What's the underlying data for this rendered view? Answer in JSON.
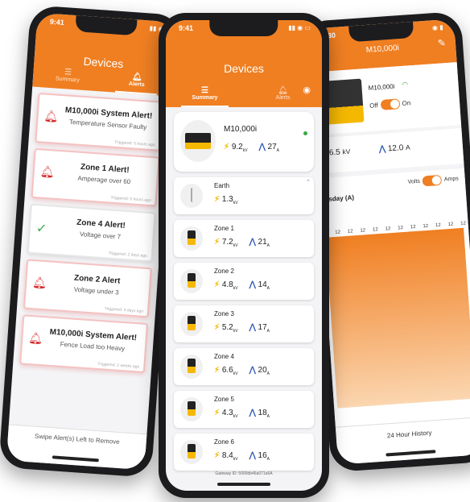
{
  "left_phone": {
    "time": "9:41",
    "title": "Devices",
    "tabs": [
      {
        "label": "Summary"
      },
      {
        "label": "Alerts"
      }
    ],
    "alerts": [
      {
        "title": "M10,000i System Alert!",
        "sub": "Temperature Sensor Faulty",
        "triggered": "Triggered: 5 hours ago",
        "icon": "bell-icon"
      },
      {
        "title": "Zone 1 Alert!",
        "sub": "Amperage over 60",
        "triggered": "Triggered: 5 hours ago",
        "icon": "bell-icon"
      },
      {
        "title": "Zone 4 Alert!",
        "sub": "Voltage over 7",
        "triggered": "Triggered: 2 days ago",
        "icon": "check-icon"
      },
      {
        "title": "Zone 2 Alert",
        "sub": "Voltage under 3",
        "triggered": "Triggered: 4 days ago",
        "icon": "bell-icon"
      },
      {
        "title": "M10,000i System Alert!",
        "sub": "Fence Load too Heavy",
        "triggered": "Triggered: 2 weeks ago",
        "icon": "bell-icon"
      }
    ],
    "footer": "Swipe Alert(s) Left to Remove"
  },
  "center_phone": {
    "time": "9:41",
    "title": "Devices",
    "tabs": [
      {
        "label": "Summary"
      },
      {
        "label": "Alerts"
      }
    ],
    "main_device": {
      "name": "M10,000i",
      "volts": "9.2",
      "volt_unit": "kV",
      "amps": "27",
      "amp_unit": "A"
    },
    "earth": {
      "name": "Earth",
      "volts": "1.3",
      "volt_unit": "kV"
    },
    "zones": [
      {
        "name": "Zone 1",
        "volts": "7.2",
        "amps": "21"
      },
      {
        "name": "Zone 2",
        "volts": "4.8",
        "amps": "14"
      },
      {
        "name": "Zone 3",
        "volts": "5.2",
        "amps": "17"
      },
      {
        "name": "Zone 4",
        "volts": "6.6",
        "amps": "20"
      },
      {
        "name": "Zone 5",
        "volts": "4.3",
        "amps": "18"
      },
      {
        "name": "Zone 6",
        "volts": "8.4",
        "amps": "16"
      }
    ],
    "units": {
      "volt": "kV",
      "amp": "A"
    },
    "gateway": "Gateway ID: 5000db46a071a6A"
  },
  "right_phone": {
    "time": "2:30",
    "title": "M10,000i",
    "device_name": "M10,000i",
    "toggle_off": "Off",
    "toggle_on": "On",
    "volts": "6.5",
    "volt_unit": "kV",
    "amps": "12.0",
    "amp_unit": "A",
    "toggle_volts": "Volts",
    "toggle_amps": "Amps",
    "chart_title": "nesday (A)",
    "history_label": "24 Hour History"
  },
  "chart_data": {
    "type": "area",
    "title": "nesday (A)",
    "xlabel": "",
    "ylabel": "",
    "x": [
      "",
      "",
      "",
      "",
      "",
      "",
      "",
      "",
      "",
      "",
      "",
      ""
    ],
    "series": [
      {
        "values": [
          12,
          12,
          12,
          12,
          12,
          12,
          12,
          12,
          12,
          12,
          12,
          12
        ]
      }
    ],
    "data_labels": [
      "12",
      "12",
      "12",
      "12",
      "12",
      "12",
      "12",
      "12",
      "12",
      "12",
      "12",
      "12"
    ],
    "color": "#f07f22"
  }
}
